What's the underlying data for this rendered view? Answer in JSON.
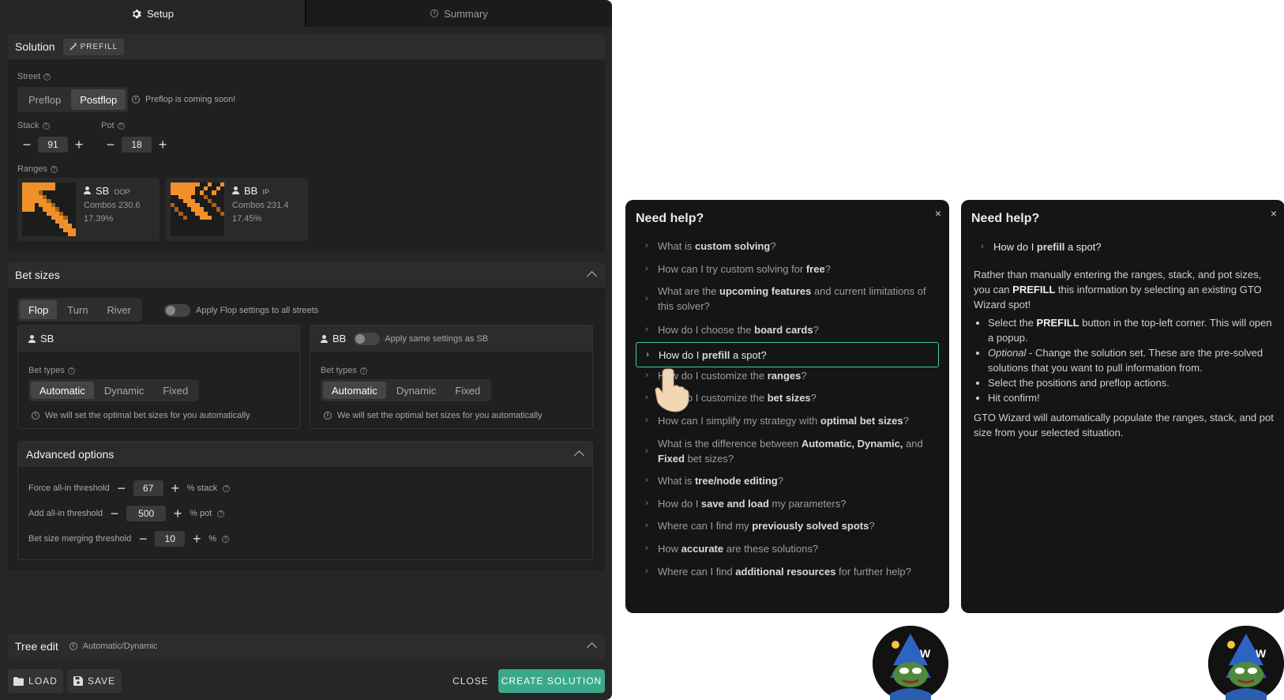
{
  "tabs": {
    "setup": "Setup",
    "summary": "Summary"
  },
  "solution": {
    "title": "Solution",
    "prefill": "PREFILL"
  },
  "street": {
    "label": "Street",
    "options": [
      "Preflop",
      "Postflop"
    ],
    "selected": "Postflop",
    "note": "Preflop is coming soon!"
  },
  "stack": {
    "label": "Stack",
    "value": "91"
  },
  "pot": {
    "label": "Pot",
    "value": "18"
  },
  "ranges": {
    "label": "Ranges",
    "sb": {
      "name": "SB",
      "pos": "OOP",
      "combos": "Combos 230.6",
      "pct": "17.39%"
    },
    "bb": {
      "name": "BB",
      "pos": "IP",
      "combos": "Combos 231.4",
      "pct": "17.45%"
    }
  },
  "betsizes": {
    "title": "Bet sizes",
    "streets": [
      "Flop",
      "Turn",
      "River"
    ],
    "selected_street": "Flop",
    "apply_all": "Apply Flop settings to all streets",
    "sb": {
      "name": "SB",
      "bet_types_label": "Bet types",
      "types": [
        "Automatic",
        "Dynamic",
        "Fixed"
      ],
      "note": "We will set the optimal bet sizes for you automatically"
    },
    "bb": {
      "name": "BB",
      "apply_same": "Apply same settings as SB",
      "bet_types_label": "Bet types",
      "types": [
        "Automatic",
        "Dynamic",
        "Fixed"
      ],
      "note": "We will set the optimal bet sizes for you automatically"
    }
  },
  "advanced": {
    "title": "Advanced options",
    "rows": [
      {
        "label": "Force all-in threshold",
        "value": "67",
        "unit": "% stack"
      },
      {
        "label": "Add all-in threshold",
        "value": "500",
        "unit": "% pot"
      },
      {
        "label": "Bet size merging threshold",
        "value": "10",
        "unit": "%"
      }
    ]
  },
  "tree": {
    "title": "Tree edit",
    "note": "Automatic/Dynamic"
  },
  "footer": {
    "load": "LOAD",
    "save": "SAVE",
    "close": "CLOSE",
    "create": "CREATE SOLUTION"
  },
  "help": {
    "title": "Need help?",
    "close": "×",
    "faq": [
      {
        "pre": "What is ",
        "b": "custom solving",
        "post": "?"
      },
      {
        "pre": "How can I try custom solving for ",
        "b": "free",
        "post": "?"
      },
      {
        "pre": "What are the ",
        "b": "upcoming features",
        "post": " and current limitations of this solver?"
      },
      {
        "pre": "How do I choose the ",
        "b": "board cards",
        "post": "?"
      },
      {
        "pre": "How do I ",
        "b": "prefill",
        "post": " a spot?"
      },
      {
        "pre": "How do I customize the ",
        "b": "ranges",
        "post": "?"
      },
      {
        "pre": "How do I customize the ",
        "b": "bet sizes",
        "post": "?"
      },
      {
        "pre": "How can I simplify my strategy with ",
        "b": "optimal bet sizes",
        "post": "?"
      },
      {
        "pre": "What is the difference between ",
        "b": "Automatic, Dynamic,",
        "post": " and ",
        "b2": "Fixed",
        "post2": " bet sizes?"
      },
      {
        "pre": "What is ",
        "b": "tree/node editing",
        "post": "?"
      },
      {
        "pre": "How do I ",
        "b": "save and load",
        "post": " my parameters?"
      },
      {
        "pre": "Where can I find my ",
        "b": "previously solved spots",
        "post": "?"
      },
      {
        "pre": "How ",
        "b": "accurate",
        "post": " are these solutions?"
      },
      {
        "pre": "Where can I find ",
        "b": "additional resources",
        "post": " for further help?"
      }
    ],
    "answer": {
      "q_pre": "How do I ",
      "q_b": "prefill",
      "q_post": " a spot?",
      "p1_pre": "Rather than manually entering the ranges, stack, and pot sizes, you can ",
      "p1_b": "PREFILL",
      "p1_post": " this information by selecting an existing GTO Wizard spot!",
      "li1_pre": "Select the ",
      "li1_b": "PREFILL",
      "li1_post": " button in the top-left corner. This will open a popup.",
      "li2_i": "Optional",
      "li2_post": " - Change the solution set. These are the pre-solved solutions that you want to pull information from.",
      "li3": "Select the positions and preflop actions.",
      "li4": "Hit confirm!",
      "p2": "GTO Wizard will automatically populate the ranges, stack, and pot size from your selected situation."
    }
  },
  "colors": {
    "accent": "#3aa98b",
    "range": "#f0902a",
    "highlight": "#4bc4a0"
  },
  "icons": [
    "gear-icon",
    "info-icon",
    "wand-icon",
    "person-icon",
    "chevron-up-icon",
    "chevron-right-icon",
    "chevron-left-icon",
    "close-icon",
    "folder-icon",
    "save-icon",
    "hand-pointer-icon",
    "wizard-avatar"
  ]
}
